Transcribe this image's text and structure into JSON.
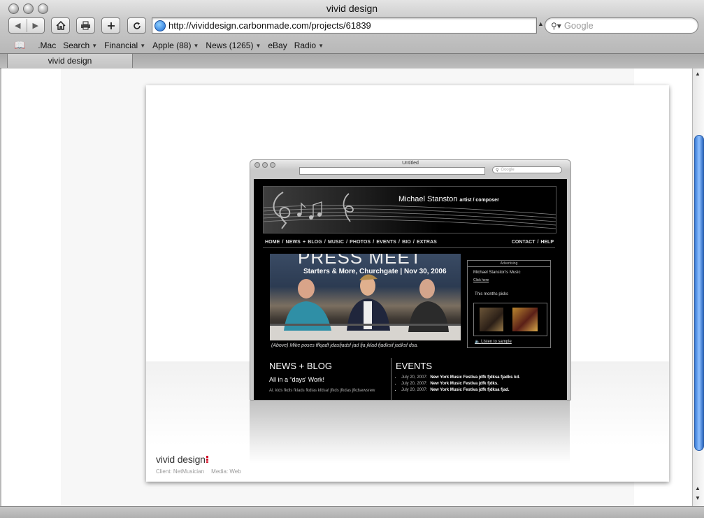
{
  "window": {
    "title": "vivid design"
  },
  "toolbar": {
    "back_label": "◀",
    "forward_label": "▶",
    "url": "http://vividdesign.carbonmade.com/projects/61839",
    "search_placeholder": "Google"
  },
  "bookmarks": [
    {
      "label": ".Mac",
      "menu": false
    },
    {
      "label": "Search",
      "menu": true
    },
    {
      "label": "Financial",
      "menu": true
    },
    {
      "label": "Apple (88)",
      "menu": true
    },
    {
      "label": "News (1265)",
      "menu": true
    },
    {
      "label": "eBay",
      "menu": false
    },
    {
      "label": "Radio",
      "menu": true
    }
  ],
  "tab": {
    "label": "vivid design"
  },
  "portfolio": {
    "logo": "vivid design",
    "client_label": "Client: NetMusician",
    "media_label": "Media: Web"
  },
  "mock": {
    "window_title": "Untitled",
    "search_placeholder": "Google",
    "site_name": "Michael Stanston",
    "site_tagline": "artist / composer",
    "nav_left": "HOME  /  NEWS + BLOG  /  MUSIC  /  PHOTOS  /  EVENTS  /  BIO  /  EXTRAS",
    "nav_right": "CONTACT  /  HELP",
    "photo_heading": "PRESS MEET",
    "photo_subheading": "Starters & More, Churchgate  |  Nov 30, 2006",
    "photo_caption": "(Above) Mike poses ffkjadf jdasfjadsf jad fja jklad fjadksif jadksf dsa.",
    "ad_heading": "Advertising",
    "ad_title": "Michael Stanston's Music",
    "ad_link": "Click here",
    "ad_picks": "This months picks",
    "ad_listen": "Listen to sample",
    "news_heading": "NEWS + BLOG",
    "news_sub": "All in a “days’ Work!",
    "news_blur": "Al. klds fkdls fklads fkdlas kfdsa! jfkds jfkdas jfkdsewsrew",
    "events_heading": "EVENTS",
    "events": [
      {
        "date": "July 20, 2007:",
        "event": "New York Music Festiva jdfk fjdksa fjadks kd."
      },
      {
        "date": "July 20, 2007:",
        "event": "New York Music Festiva jdfk fjdks."
      },
      {
        "date": "July 20, 2007:",
        "event": "New York Music Festiva jdfk fjdksa fjad."
      }
    ]
  }
}
